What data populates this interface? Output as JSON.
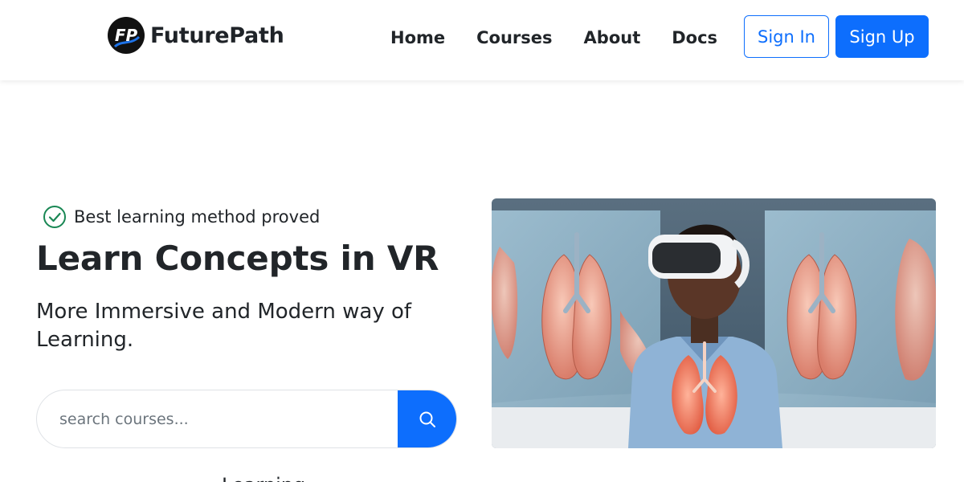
{
  "brand": {
    "name": "FuturePath",
    "logo_text": "FP"
  },
  "nav": {
    "links": [
      "Home",
      "Courses",
      "About",
      "Docs"
    ]
  },
  "auth": {
    "signin_label": "Sign In",
    "signup_label": "Sign Up"
  },
  "hero": {
    "badge_text": "Best learning method proved",
    "title": "Learn Concepts in VR",
    "subtitle": "More Immersive and Modern way of Learning.",
    "search_placeholder": "search courses...",
    "next_section_partial": "Learning"
  },
  "colors": {
    "primary": "#0d6efd",
    "text": "#212529",
    "success": "#198754"
  },
  "icons": {
    "badge": "check-circle-icon",
    "search": "search-icon"
  }
}
